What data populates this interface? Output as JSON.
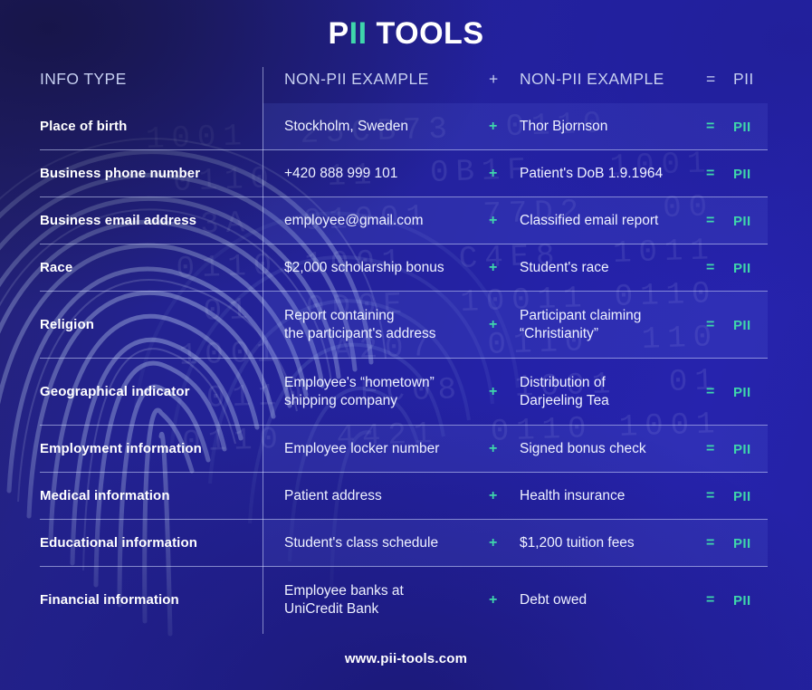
{
  "brand": {
    "part_p": "P",
    "part_ii": "II",
    "part_rest": " TOOLS",
    "full": "PII TOOLS",
    "accent_color": "#3fd6ab"
  },
  "footer": {
    "url": "www.pii-tools.com"
  },
  "theme": {
    "background_dark": "#24226f",
    "background_mid": "#2422a6",
    "accent_teal": "#3fd6ab",
    "text_primary": "#ffffff",
    "text_header": "#c6cff0",
    "rule_color": "#d6deff"
  },
  "table": {
    "headers": {
      "info_type": "INFO TYPE",
      "example_1": "NON-PII EXAMPLE",
      "plus": "+",
      "example_2": "NON-PII EXAMPLE",
      "equals": "=",
      "result": "PII"
    },
    "symbols": {
      "plus": "+",
      "equals": "=",
      "result": "PII"
    },
    "rows": [
      {
        "info_type": "Place of birth",
        "example_1": "Stockholm, Sweden",
        "plus": "+",
        "example_2": "Thor Bjornson",
        "equals": "=",
        "result": "PII"
      },
      {
        "info_type": "Business phone number",
        "example_1": "+420 888 999 101",
        "plus": "+",
        "example_2": "Patient's DoB 1.9.1964",
        "equals": "=",
        "result": "PII"
      },
      {
        "info_type": "Business email address",
        "example_1": "employee@gmail.com",
        "plus": "+",
        "example_2": "Classified email report",
        "equals": "=",
        "result": "PII"
      },
      {
        "info_type": "Race",
        "example_1": "$2,000 scholarship bonus",
        "plus": "+",
        "example_2": "Student's race",
        "equals": "=",
        "result": "PII"
      },
      {
        "info_type": "Religion",
        "example_1": "Report containing\nthe participant's address",
        "plus": "+",
        "example_2": "Participant claiming\n“Christianity”",
        "equals": "=",
        "result": "PII"
      },
      {
        "info_type": "Geographical indicator",
        "example_1": "Employee's “hometown”\nshipping company",
        "plus": "+",
        "example_2": "Distribution of\nDarjeeling Tea",
        "equals": "=",
        "result": "PII"
      },
      {
        "info_type": "Employment information",
        "example_1": "Employee locker number",
        "plus": "+",
        "example_2": "Signed bonus check",
        "equals": "=",
        "result": "PII"
      },
      {
        "info_type": "Medical information",
        "example_1": "Patient address",
        "plus": "+",
        "example_2": "Health insurance",
        "equals": "=",
        "result": "PII"
      },
      {
        "info_type": "Educational information",
        "example_1": "Student's class schedule",
        "plus": "+",
        "example_2": "$1,200 tuition fees",
        "equals": "=",
        "result": "PII"
      },
      {
        "info_type": "Financial information",
        "example_1": "Employee banks at\nUniCredit Bank",
        "plus": "+",
        "example_2": "Debt owed",
        "equals": "=",
        "result": "PII"
      }
    ]
  }
}
